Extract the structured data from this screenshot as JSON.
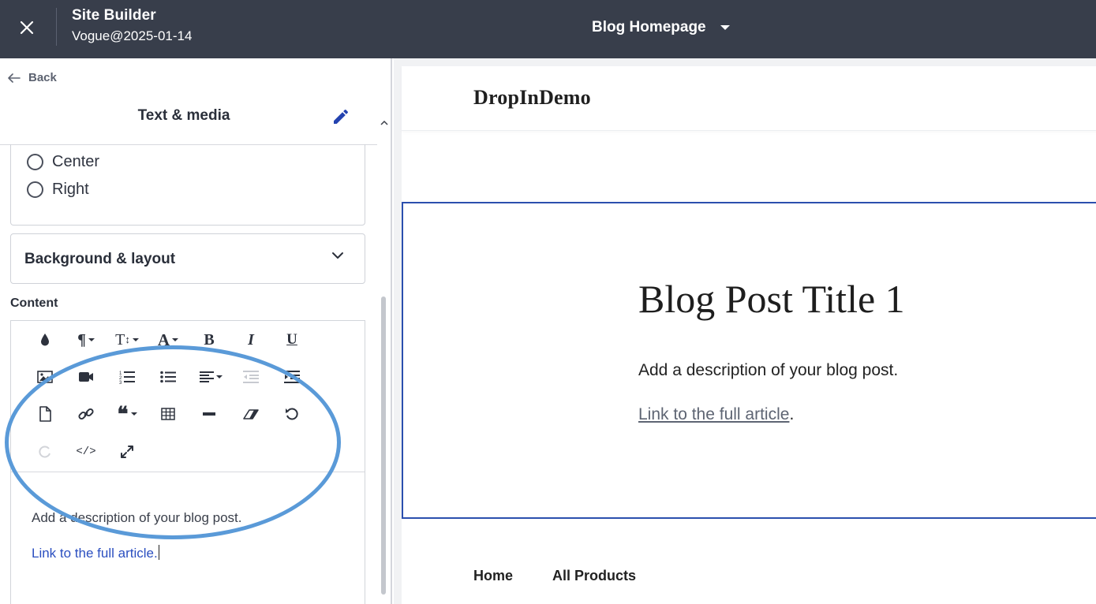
{
  "topbar": {
    "title": "Site Builder",
    "subtitle": "Vogue@2025-01-14",
    "page_selector": "Blog Homepage"
  },
  "left_panel": {
    "back_label": "Back",
    "title": "Text & media",
    "alignment_options": [
      "Center",
      "Right"
    ],
    "background_layout_label": "Background & layout",
    "content_label": "Content",
    "toolbar_icons": [
      "color-drop-icon",
      "paragraph-icon",
      "text-size-icon",
      "font-icon",
      "bold-icon",
      "italic-icon",
      "underline-icon",
      "image-icon",
      "video-icon",
      "ordered-list-icon",
      "unordered-list-icon",
      "align-icon",
      "outdent-icon",
      "indent-icon",
      "file-icon",
      "link-icon",
      "quote-icon",
      "table-icon",
      "horizontal-rule-icon",
      "eraser-icon",
      "undo-icon",
      "redo-icon",
      "code-view-icon",
      "fullscreen-icon"
    ],
    "editor_text": "Add a description of your blog post.",
    "editor_link": "Link to the full article."
  },
  "preview": {
    "site_name": "DropInDemo",
    "post_title": "Blog Post Title 1",
    "post_description": "Add a description of your blog post.",
    "post_link": "Link to the full article",
    "post_link_suffix": ".",
    "nav": [
      "Home",
      "All Products"
    ]
  },
  "colors": {
    "topbar_bg": "#383e4b",
    "accent_blue": "#2b4fae",
    "annotation_circle": "#5a9ad8",
    "editor_link": "#2b4fc0"
  }
}
